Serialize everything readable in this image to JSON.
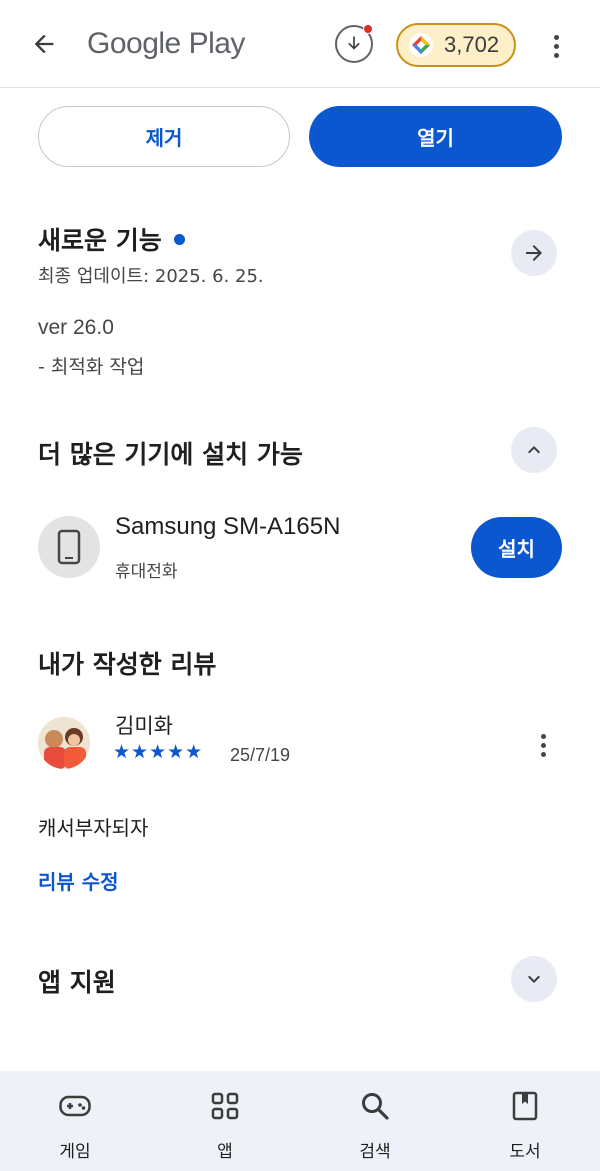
{
  "header": {
    "logo": "Google Play",
    "points": "3,702"
  },
  "actions": {
    "remove": "제거",
    "open": "열기"
  },
  "whats_new": {
    "title": "새로운 기능",
    "updated": "최종 업데이트: 2025. 6. 25.",
    "version": "ver 26.0",
    "notes": "- 최적화 작업"
  },
  "more_devices": {
    "title": "더 많은 기기에 설치 가능",
    "device_name": "Samsung SM-A165N",
    "device_type": "휴대전화",
    "install": "설치"
  },
  "my_review": {
    "title": "내가 작성한 리뷰",
    "reviewer": "김미화",
    "stars": "★★★★★",
    "rating": 5,
    "date": "25/7/19",
    "text": "캐서부자되자",
    "edit": "리뷰 수정"
  },
  "app_support": {
    "title": "앱 지원"
  },
  "bottom_nav": [
    {
      "label": "게임",
      "icon": "gamepad-icon"
    },
    {
      "label": "앱",
      "icon": "apps-grid-icon"
    },
    {
      "label": "검색",
      "icon": "search-icon"
    },
    {
      "label": "도서",
      "icon": "book-icon"
    }
  ],
  "colors": {
    "accent": "#0b57d0",
    "points_border": "#c89216",
    "points_bg": "#fdf0c8"
  }
}
